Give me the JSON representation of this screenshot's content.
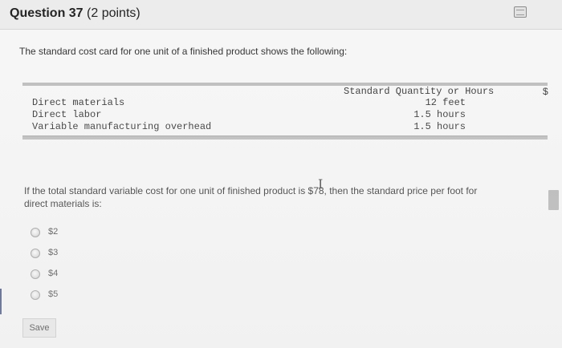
{
  "header": {
    "title": "Question 37",
    "points": "(2 points)",
    "icon": "notepad-icon"
  },
  "intro": "The standard cost card for one unit of a finished product shows the following:",
  "cost_card": {
    "header_qty": "Standard Quantity or Hours",
    "header_price": "$",
    "rows": [
      {
        "label": "Direct materials",
        "value": "12 feet"
      },
      {
        "label": "Direct labor",
        "value": "1.5 hours"
      },
      {
        "label": "Variable manufacturing overhead",
        "value": "1.5 hours"
      }
    ]
  },
  "question": {
    "line1": "If the total standard variable cost for one unit of finished product is $78, then the standard price per foot for",
    "line2": "direct materials is:"
  },
  "options": [
    {
      "label": "$2",
      "selected": false
    },
    {
      "label": "$3",
      "selected": false
    },
    {
      "label": "$4",
      "selected": false
    },
    {
      "label": "$5",
      "selected": false
    }
  ],
  "save_label": "Save"
}
